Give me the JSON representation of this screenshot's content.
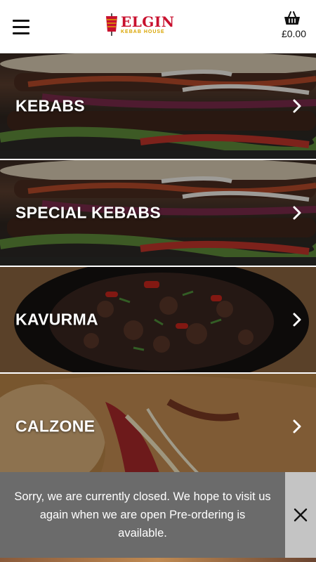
{
  "header": {
    "menu_icon": "hamburger-menu-icon",
    "logo_name": "ELGIN",
    "logo_sub": "KEBAB HOUSE",
    "basket_icon": "shopping-basket-icon",
    "basket_total": "£0.00"
  },
  "categories": [
    {
      "label": "KEBABS"
    },
    {
      "label": "SPECIAL KEBABS"
    },
    {
      "label": "KAVURMA"
    },
    {
      "label": "CALZONE"
    }
  ],
  "notice": {
    "message": "Sorry, we are currently closed. We hope to visit us again when we are open Pre-ordering is available.",
    "close_icon": "close-icon"
  },
  "colors": {
    "brand_red": "#c8102e",
    "brand_gold": "#d9a400",
    "banner_bg": "#6b6b6b",
    "banner_close_bg": "#c4c4c4"
  }
}
